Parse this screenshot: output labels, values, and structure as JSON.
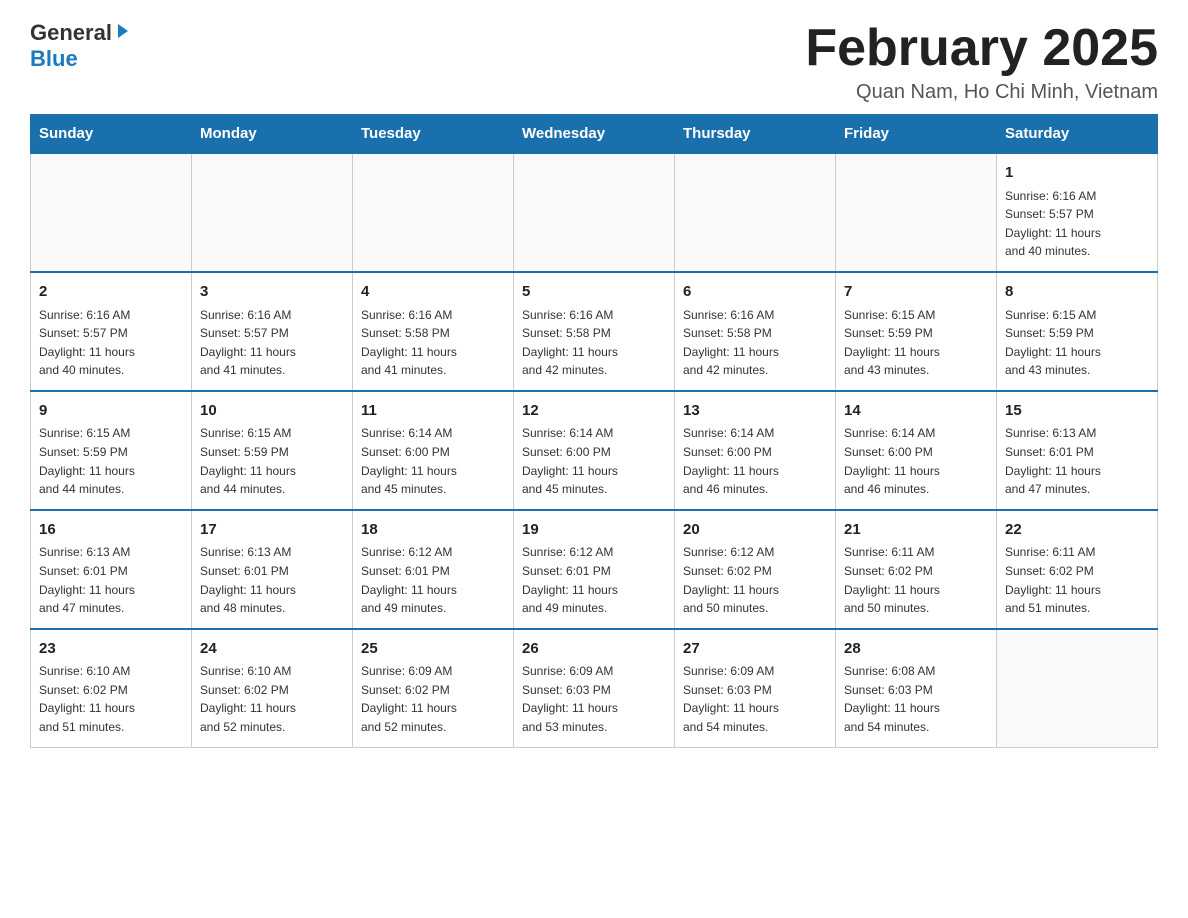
{
  "header": {
    "logo_general": "General",
    "logo_blue": "Blue",
    "month_title": "February 2025",
    "location": "Quan Nam, Ho Chi Minh, Vietnam"
  },
  "calendar": {
    "days_of_week": [
      "Sunday",
      "Monday",
      "Tuesday",
      "Wednesday",
      "Thursday",
      "Friday",
      "Saturday"
    ],
    "weeks": [
      [
        {
          "day": "",
          "info": ""
        },
        {
          "day": "",
          "info": ""
        },
        {
          "day": "",
          "info": ""
        },
        {
          "day": "",
          "info": ""
        },
        {
          "day": "",
          "info": ""
        },
        {
          "day": "",
          "info": ""
        },
        {
          "day": "1",
          "info": "Sunrise: 6:16 AM\nSunset: 5:57 PM\nDaylight: 11 hours\nand 40 minutes."
        }
      ],
      [
        {
          "day": "2",
          "info": "Sunrise: 6:16 AM\nSunset: 5:57 PM\nDaylight: 11 hours\nand 40 minutes."
        },
        {
          "day": "3",
          "info": "Sunrise: 6:16 AM\nSunset: 5:57 PM\nDaylight: 11 hours\nand 41 minutes."
        },
        {
          "day": "4",
          "info": "Sunrise: 6:16 AM\nSunset: 5:58 PM\nDaylight: 11 hours\nand 41 minutes."
        },
        {
          "day": "5",
          "info": "Sunrise: 6:16 AM\nSunset: 5:58 PM\nDaylight: 11 hours\nand 42 minutes."
        },
        {
          "day": "6",
          "info": "Sunrise: 6:16 AM\nSunset: 5:58 PM\nDaylight: 11 hours\nand 42 minutes."
        },
        {
          "day": "7",
          "info": "Sunrise: 6:15 AM\nSunset: 5:59 PM\nDaylight: 11 hours\nand 43 minutes."
        },
        {
          "day": "8",
          "info": "Sunrise: 6:15 AM\nSunset: 5:59 PM\nDaylight: 11 hours\nand 43 minutes."
        }
      ],
      [
        {
          "day": "9",
          "info": "Sunrise: 6:15 AM\nSunset: 5:59 PM\nDaylight: 11 hours\nand 44 minutes."
        },
        {
          "day": "10",
          "info": "Sunrise: 6:15 AM\nSunset: 5:59 PM\nDaylight: 11 hours\nand 44 minutes."
        },
        {
          "day": "11",
          "info": "Sunrise: 6:14 AM\nSunset: 6:00 PM\nDaylight: 11 hours\nand 45 minutes."
        },
        {
          "day": "12",
          "info": "Sunrise: 6:14 AM\nSunset: 6:00 PM\nDaylight: 11 hours\nand 45 minutes."
        },
        {
          "day": "13",
          "info": "Sunrise: 6:14 AM\nSunset: 6:00 PM\nDaylight: 11 hours\nand 46 minutes."
        },
        {
          "day": "14",
          "info": "Sunrise: 6:14 AM\nSunset: 6:00 PM\nDaylight: 11 hours\nand 46 minutes."
        },
        {
          "day": "15",
          "info": "Sunrise: 6:13 AM\nSunset: 6:01 PM\nDaylight: 11 hours\nand 47 minutes."
        }
      ],
      [
        {
          "day": "16",
          "info": "Sunrise: 6:13 AM\nSunset: 6:01 PM\nDaylight: 11 hours\nand 47 minutes."
        },
        {
          "day": "17",
          "info": "Sunrise: 6:13 AM\nSunset: 6:01 PM\nDaylight: 11 hours\nand 48 minutes."
        },
        {
          "day": "18",
          "info": "Sunrise: 6:12 AM\nSunset: 6:01 PM\nDaylight: 11 hours\nand 49 minutes."
        },
        {
          "day": "19",
          "info": "Sunrise: 6:12 AM\nSunset: 6:01 PM\nDaylight: 11 hours\nand 49 minutes."
        },
        {
          "day": "20",
          "info": "Sunrise: 6:12 AM\nSunset: 6:02 PM\nDaylight: 11 hours\nand 50 minutes."
        },
        {
          "day": "21",
          "info": "Sunrise: 6:11 AM\nSunset: 6:02 PM\nDaylight: 11 hours\nand 50 minutes."
        },
        {
          "day": "22",
          "info": "Sunrise: 6:11 AM\nSunset: 6:02 PM\nDaylight: 11 hours\nand 51 minutes."
        }
      ],
      [
        {
          "day": "23",
          "info": "Sunrise: 6:10 AM\nSunset: 6:02 PM\nDaylight: 11 hours\nand 51 minutes."
        },
        {
          "day": "24",
          "info": "Sunrise: 6:10 AM\nSunset: 6:02 PM\nDaylight: 11 hours\nand 52 minutes."
        },
        {
          "day": "25",
          "info": "Sunrise: 6:09 AM\nSunset: 6:02 PM\nDaylight: 11 hours\nand 52 minutes."
        },
        {
          "day": "26",
          "info": "Sunrise: 6:09 AM\nSunset: 6:03 PM\nDaylight: 11 hours\nand 53 minutes."
        },
        {
          "day": "27",
          "info": "Sunrise: 6:09 AM\nSunset: 6:03 PM\nDaylight: 11 hours\nand 54 minutes."
        },
        {
          "day": "28",
          "info": "Sunrise: 6:08 AM\nSunset: 6:03 PM\nDaylight: 11 hours\nand 54 minutes."
        },
        {
          "day": "",
          "info": ""
        }
      ]
    ]
  }
}
